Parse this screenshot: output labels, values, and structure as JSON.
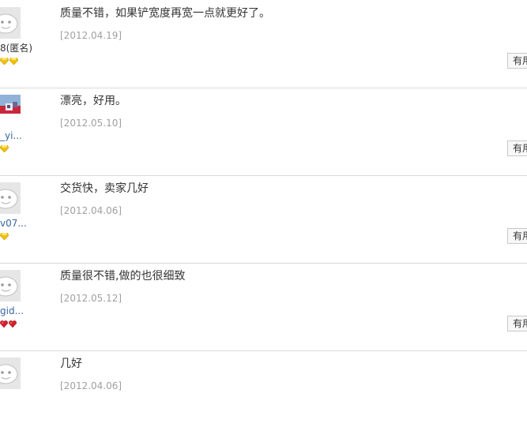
{
  "reviews": [
    {
      "user": "8(匿名)",
      "content": "质量不错，如果铲宽度再宽一点就更好了。",
      "date": "[2012.04.19]",
      "useful": "有用",
      "avatar": "default-avatar",
      "level_icons": [
        "gold-diamond-icon",
        "gold-diamond-icon"
      ]
    },
    {
      "user": "_yi...",
      "content": "漂亮，好用。",
      "date": "[2012.05.10]",
      "useful": "有用",
      "avatar": "photo-avatar",
      "level_icons": [
        "gold-diamond-icon"
      ]
    },
    {
      "user": "v07...",
      "content": "交货快，卖家几好",
      "date": "[2012.04.06]",
      "useful": "有用",
      "avatar": "default-avatar",
      "level_icons": [
        "gold-diamond-icon"
      ]
    },
    {
      "user": "gid...",
      "content": "质量很不错,做的也很细致",
      "date": "[2012.05.12]",
      "useful": "有用",
      "avatar": "default-avatar",
      "level_icons": [
        "red-heart-icon",
        "red-heart-icon"
      ]
    },
    {
      "user": "",
      "content": "几好",
      "date": "[2012.04.06]",
      "useful": "",
      "avatar": "default-avatar",
      "level_icons": []
    }
  ],
  "colors": {
    "divider": "#d8d8d8",
    "date": "#a0a0a0",
    "username_link": "#3665a8",
    "gold_diamond": "#f2c200",
    "red_heart": "#d6202c"
  }
}
